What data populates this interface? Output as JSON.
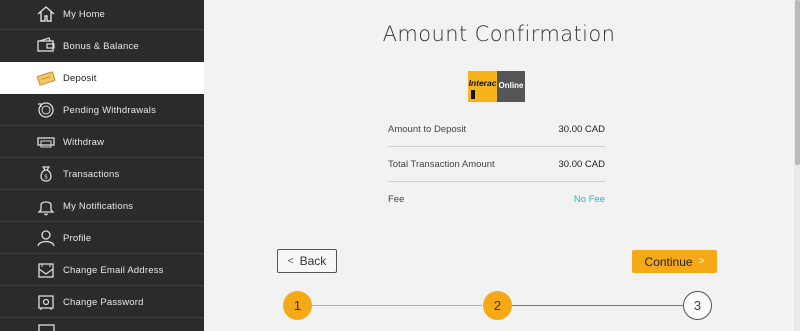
{
  "sidebar": {
    "items": [
      {
        "label": "My Home",
        "icon": "home-icon"
      },
      {
        "label": "Bonus & Balance",
        "icon": "wallet-icon"
      },
      {
        "label": "Deposit",
        "icon": "deposit-icon",
        "active": true
      },
      {
        "label": "Pending Withdrawals",
        "icon": "pending-withdrawals-icon"
      },
      {
        "label": "Withdraw",
        "icon": "withdraw-icon"
      },
      {
        "label": "Transactions",
        "icon": "money-bag-icon"
      },
      {
        "label": "My Notifications",
        "icon": "bell-icon"
      },
      {
        "label": "Profile",
        "icon": "user-icon"
      },
      {
        "label": "Change Email Address",
        "icon": "envelope-icon"
      },
      {
        "label": "Change Password",
        "icon": "safe-icon"
      }
    ]
  },
  "main": {
    "title": "Amount Confirmation",
    "logo": {
      "left_text": "Interac",
      "right_text": "Online"
    },
    "rows": [
      {
        "key": "Amount to Deposit",
        "value": "30.00 CAD"
      },
      {
        "key": "Total Transaction Amount",
        "value": "30.00 CAD"
      },
      {
        "key": "Fee",
        "value": "No Fee"
      }
    ],
    "back_label": "Back",
    "continue_label": "Continue",
    "steps": [
      "1",
      "2",
      "3"
    ],
    "current_step": 2
  },
  "colors": {
    "accent": "#f6a917",
    "fee": "#20b8c8",
    "sidebar_bg": "#2b2b2b"
  }
}
